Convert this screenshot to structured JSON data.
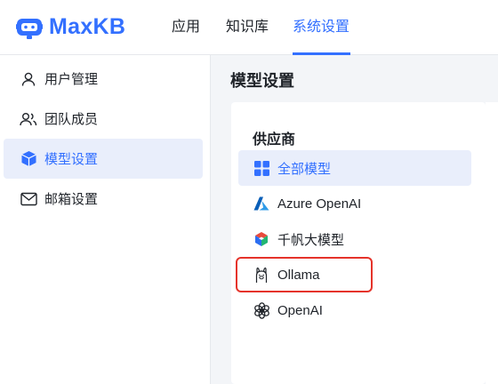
{
  "app": {
    "name": "MaxKB",
    "brand_color": "#3370ff"
  },
  "topnav": {
    "items": [
      {
        "label": "应用",
        "active": false
      },
      {
        "label": "知识库",
        "active": false
      },
      {
        "label": "系统设置",
        "active": true
      }
    ]
  },
  "sidebar": {
    "items": [
      {
        "label": "用户管理",
        "icon": "user-icon",
        "active": false
      },
      {
        "label": "团队成员",
        "icon": "team-icon",
        "active": false
      },
      {
        "label": "模型设置",
        "icon": "cube-icon",
        "active": true
      },
      {
        "label": "邮箱设置",
        "icon": "mail-icon",
        "active": false
      }
    ]
  },
  "main": {
    "title": "模型设置",
    "providers": {
      "title": "供应商",
      "items": [
        {
          "label": "全部模型",
          "icon": "grid-icon",
          "active": true
        },
        {
          "label": "Azure OpenAI",
          "icon": "azure-icon",
          "active": false
        },
        {
          "label": "千帆大模型",
          "icon": "qianfan-icon",
          "active": false
        },
        {
          "label": "Ollama",
          "icon": "ollama-icon",
          "active": false,
          "highlighted": true
        },
        {
          "label": "OpenAI",
          "icon": "openai-icon",
          "active": false
        }
      ]
    },
    "highlight_color": "#e5332a"
  }
}
